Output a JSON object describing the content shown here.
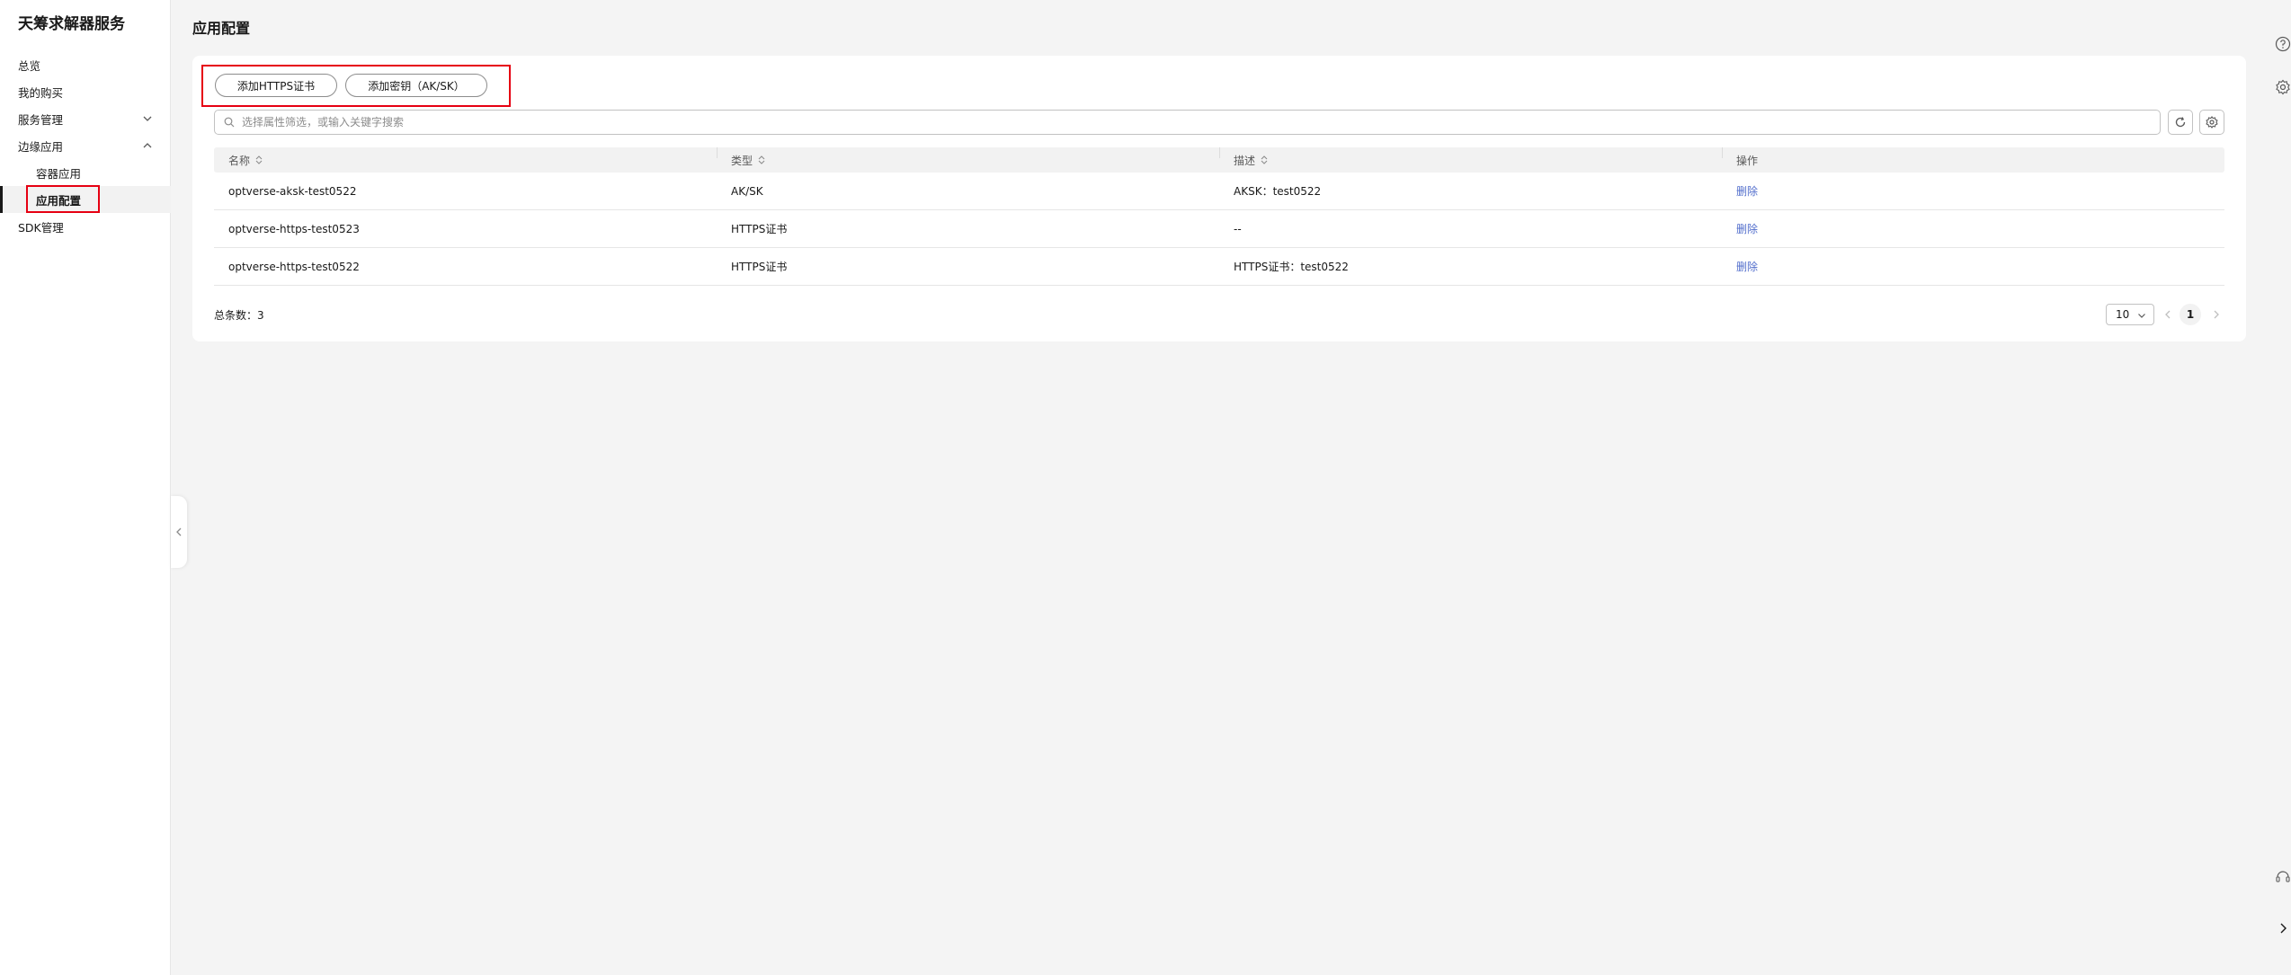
{
  "sidebar": {
    "service_title": "天筹求解器服务",
    "items": [
      {
        "label": "总览"
      },
      {
        "label": "我的购买"
      },
      {
        "label": "服务管理"
      },
      {
        "label": "边缘应用"
      },
      {
        "label": "容器应用"
      },
      {
        "label": "应用配置"
      },
      {
        "label": "SDK管理"
      }
    ]
  },
  "page": {
    "title": "应用配置"
  },
  "toolbar": {
    "add_https_label": "添加HTTPS证书",
    "add_aksk_label": "添加密钥（AK/SK）"
  },
  "search": {
    "placeholder": "选择属性筛选，或输入关键字搜索"
  },
  "table": {
    "columns": [
      "名称",
      "类型",
      "描述",
      "操作"
    ],
    "rows": [
      {
        "name": "optverse-aksk-test0522",
        "type": "AK/SK",
        "desc": "AKSK：test0522",
        "action": "删除"
      },
      {
        "name": "optverse-https-test0523",
        "type": "HTTPS证书",
        "desc": "--",
        "action": "删除"
      },
      {
        "name": "optverse-https-test0522",
        "type": "HTTPS证书",
        "desc": "HTTPS证书：test0522",
        "action": "删除"
      }
    ]
  },
  "footer": {
    "total_label": "总条数：3",
    "page_size": "10",
    "current_page": "1"
  },
  "colors": {
    "link": "#526ecc",
    "highlight": "#e60012"
  },
  "icons": [
    "search-icon",
    "refresh-icon",
    "settings-icon",
    "chevron-down-icon",
    "chevron-up-icon",
    "chevron-left-icon",
    "chevron-right-icon",
    "help-icon",
    "gear-icon",
    "headset-icon",
    "sort-icon"
  ]
}
